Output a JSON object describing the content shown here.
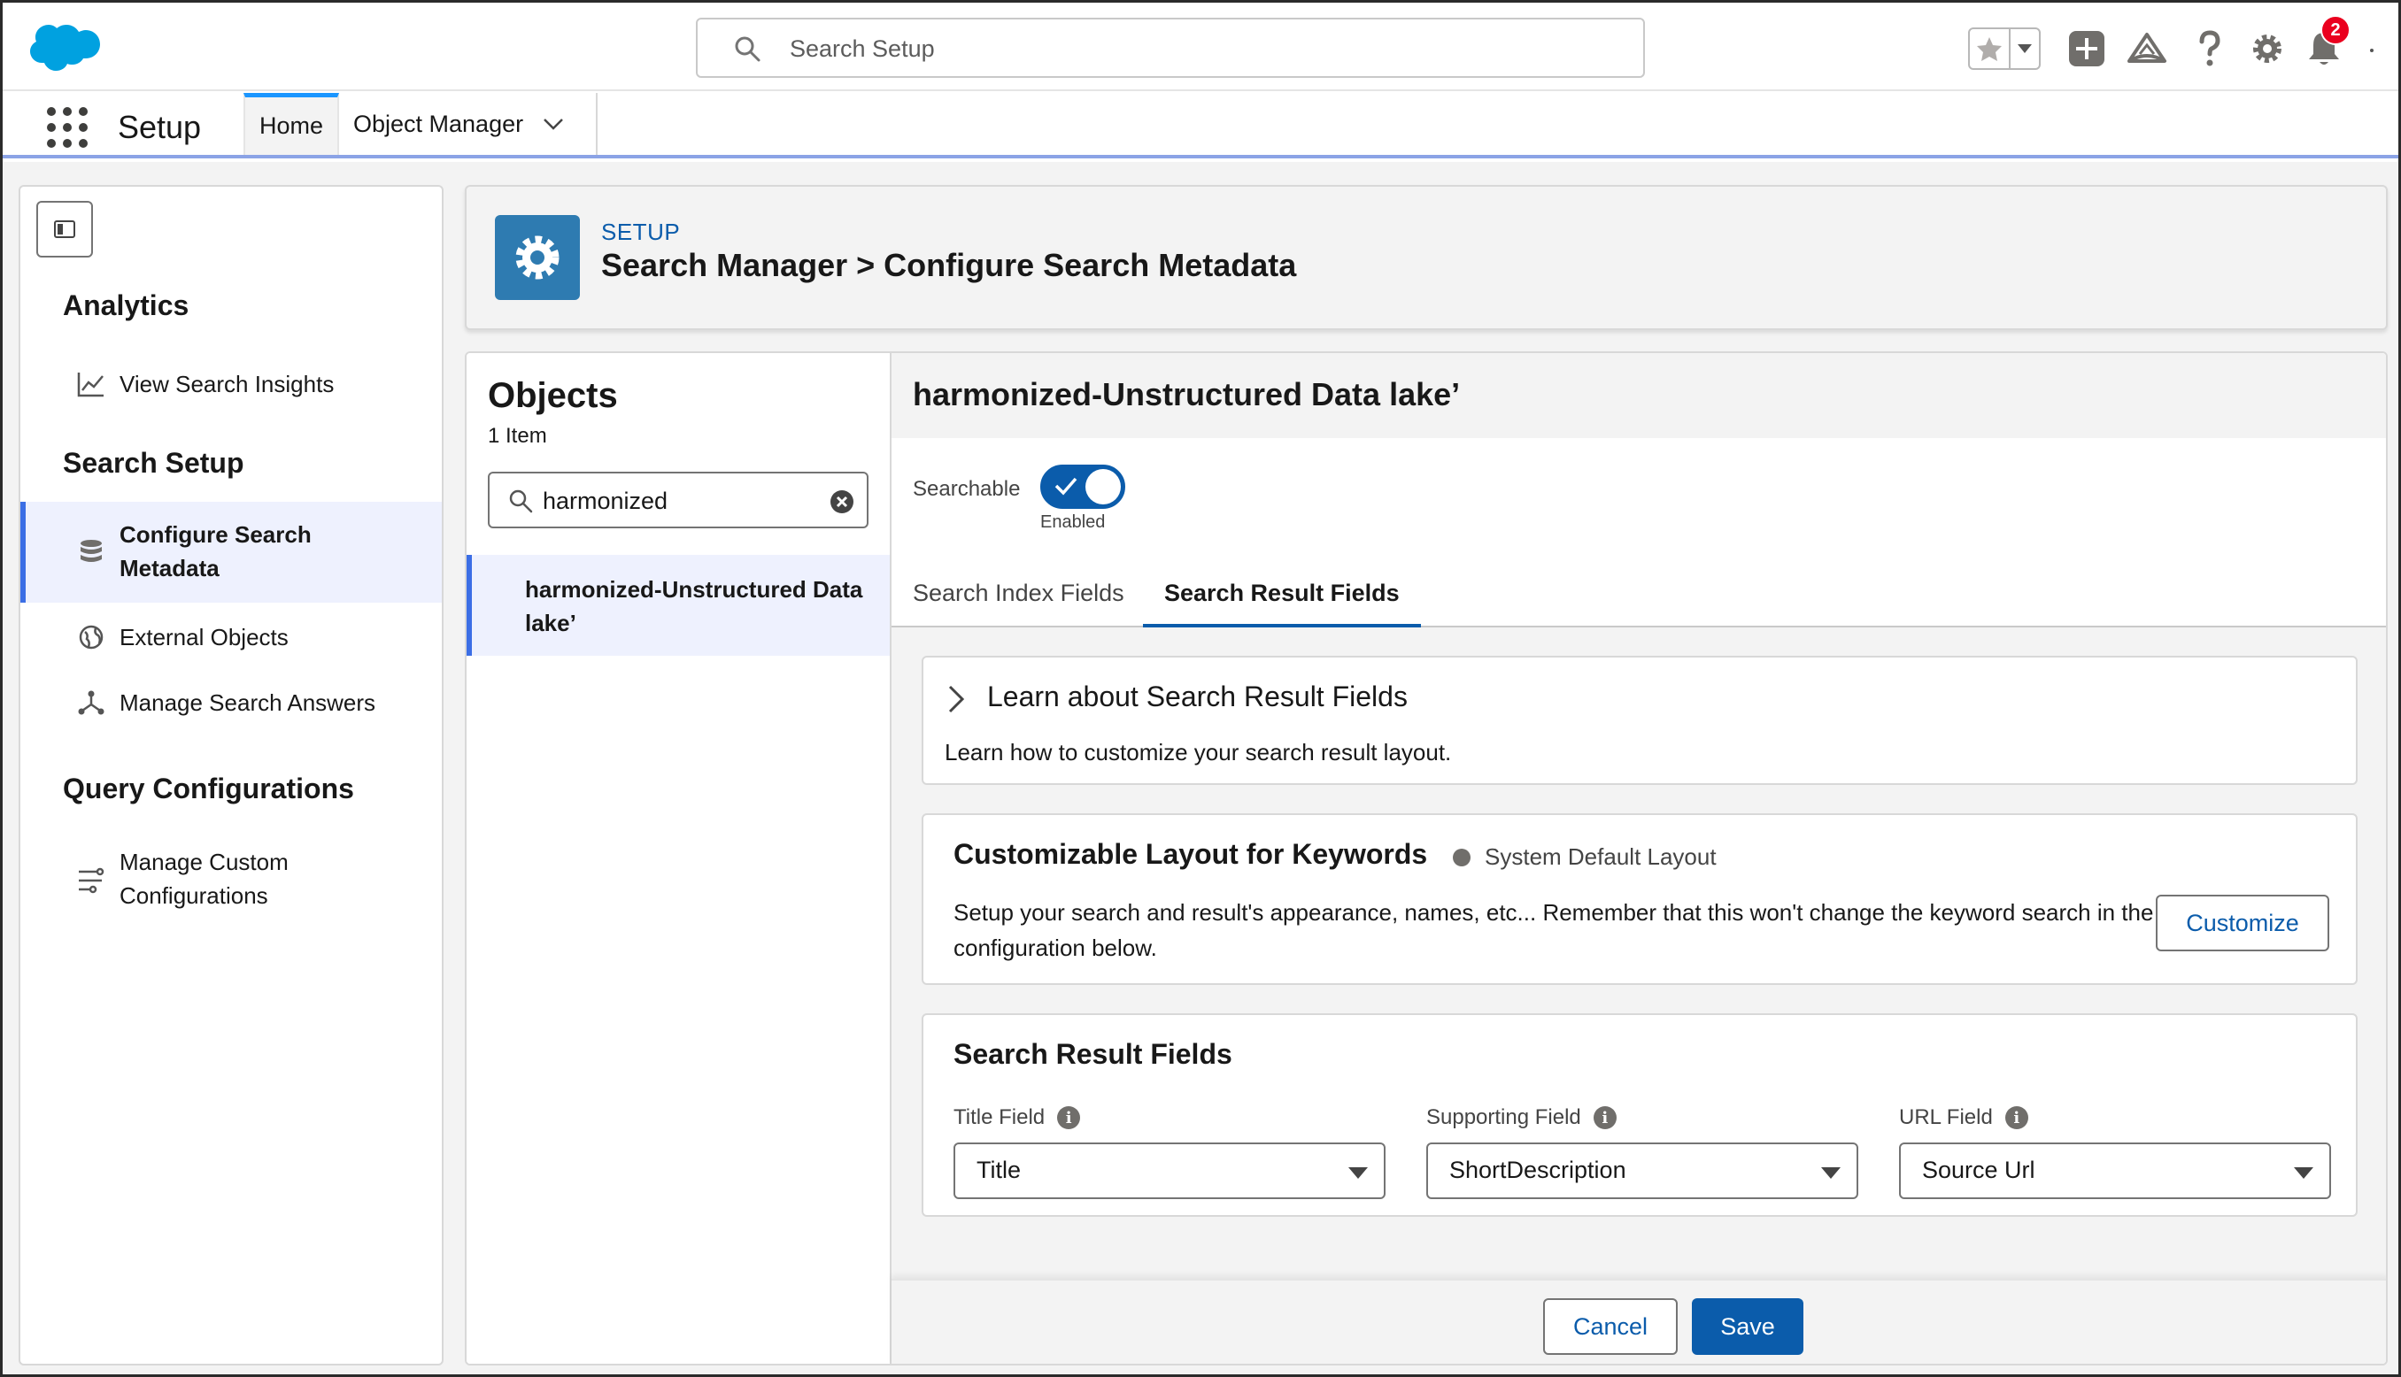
{
  "header": {
    "search_placeholder": "Search Setup",
    "notification_count": "2",
    "icons": [
      "favorites-star-icon",
      "favorites-dropdown-icon",
      "global-add-icon",
      "trailhead-icon",
      "help-icon",
      "setup-gear-icon",
      "notifications-bell-icon"
    ]
  },
  "app_nav": {
    "app_name": "Setup",
    "tabs": [
      {
        "label": "Home",
        "active": true
      },
      {
        "label": "Object Manager",
        "active": false
      }
    ]
  },
  "sidebar": {
    "sections": [
      {
        "heading": "Analytics",
        "items": [
          {
            "label": "View Search Insights",
            "icon": "line-chart-icon"
          }
        ]
      },
      {
        "heading": "Search Setup",
        "items": [
          {
            "label": "Configure Search Metadata",
            "icon": "database-icon",
            "active": true
          },
          {
            "label": "External Objects",
            "icon": "globe-icon"
          },
          {
            "label": "Manage Search Answers",
            "icon": "hierarchy-icon"
          }
        ]
      },
      {
        "heading": "Query Configurations",
        "items": [
          {
            "label": "Manage Custom Configurations",
            "icon": "filter-flow-icon"
          }
        ]
      }
    ]
  },
  "page_header": {
    "eyebrow": "SETUP",
    "title": "Search Manager > Configure Search Metadata"
  },
  "objects": {
    "heading": "Objects",
    "count": "1 Item",
    "search_value": "harmonized",
    "items": [
      {
        "label": "harmonized-Unstructured Data lake’",
        "selected": true
      }
    ]
  },
  "detail": {
    "title": "harmonized-Unstructured Data lake’",
    "searchable_label": "Searchable",
    "searchable_state": "Enabled",
    "searchable_on": true,
    "tabs": [
      {
        "label": "Search Index Fields",
        "active": false
      },
      {
        "label": "Search Result Fields",
        "active": true
      }
    ],
    "learn": {
      "heading": "Learn about Search Result Fields",
      "text": "Learn how to customize your search result layout."
    },
    "layout": {
      "heading": "Customizable Layout for Keywords",
      "status": "System Default Layout",
      "text": "Setup your search and result's appearance, names, etc... Remember that this won't change the keyword search in the configuration below.",
      "button": "Customize"
    },
    "fields": {
      "heading": "Search Result Fields",
      "items": [
        {
          "label": "Title Field",
          "value": "Title"
        },
        {
          "label": "Supporting Field",
          "value": "ShortDescription"
        },
        {
          "label": "URL Field",
          "value": "Source Url"
        }
      ]
    },
    "footer": {
      "cancel": "Cancel",
      "save": "Save"
    }
  },
  "colors": {
    "brand_blue": "#0b5cab",
    "active_tab_blue": "#1b96ff",
    "selected_bg": "#eef1fe",
    "setup_tile": "#2e7bb1",
    "badge_red": "#ea001e"
  }
}
